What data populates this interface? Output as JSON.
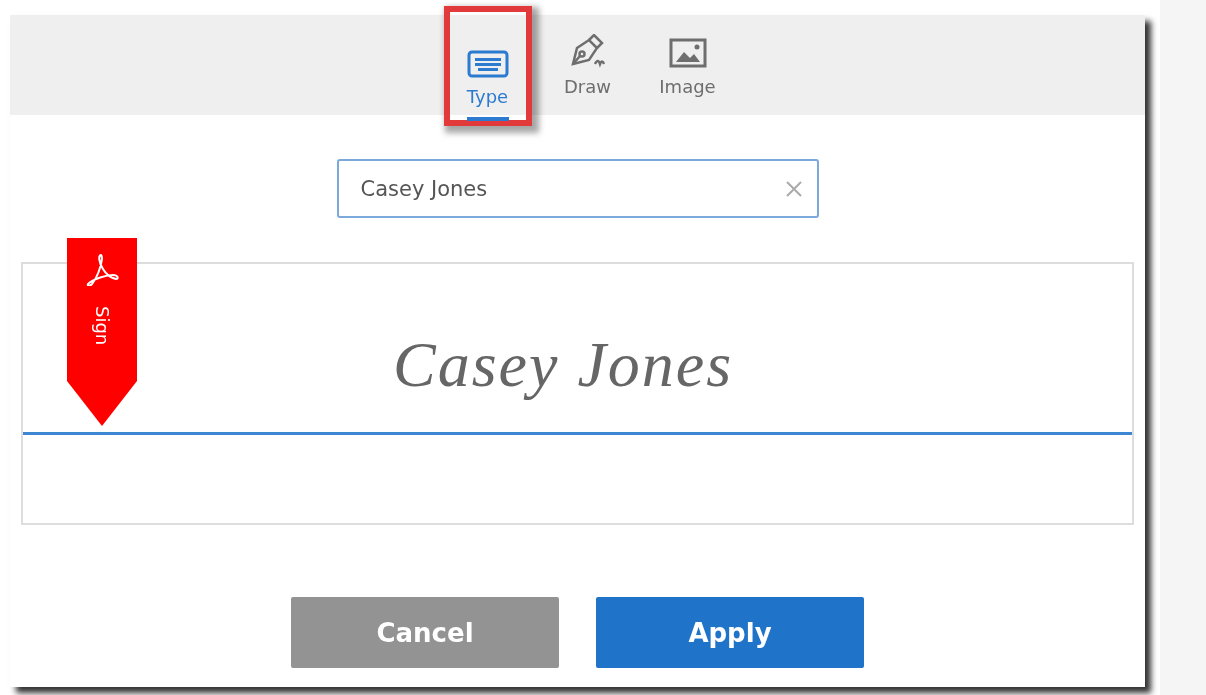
{
  "tabs": [
    {
      "kind": "type",
      "label": "Type",
      "selected": true,
      "highlighted": true
    },
    {
      "kind": "draw",
      "label": "Draw",
      "selected": false,
      "highlighted": false
    },
    {
      "kind": "image",
      "label": "Image",
      "selected": false,
      "highlighted": false
    }
  ],
  "name_field": {
    "value": "Casey Jones"
  },
  "signature": {
    "text": "Casey Jones",
    "flag_label": "Sign"
  },
  "buttons": [
    {
      "kind": "secondary",
      "label": "Cancel"
    },
    {
      "kind": "primary",
      "label": "Apply"
    }
  ]
}
